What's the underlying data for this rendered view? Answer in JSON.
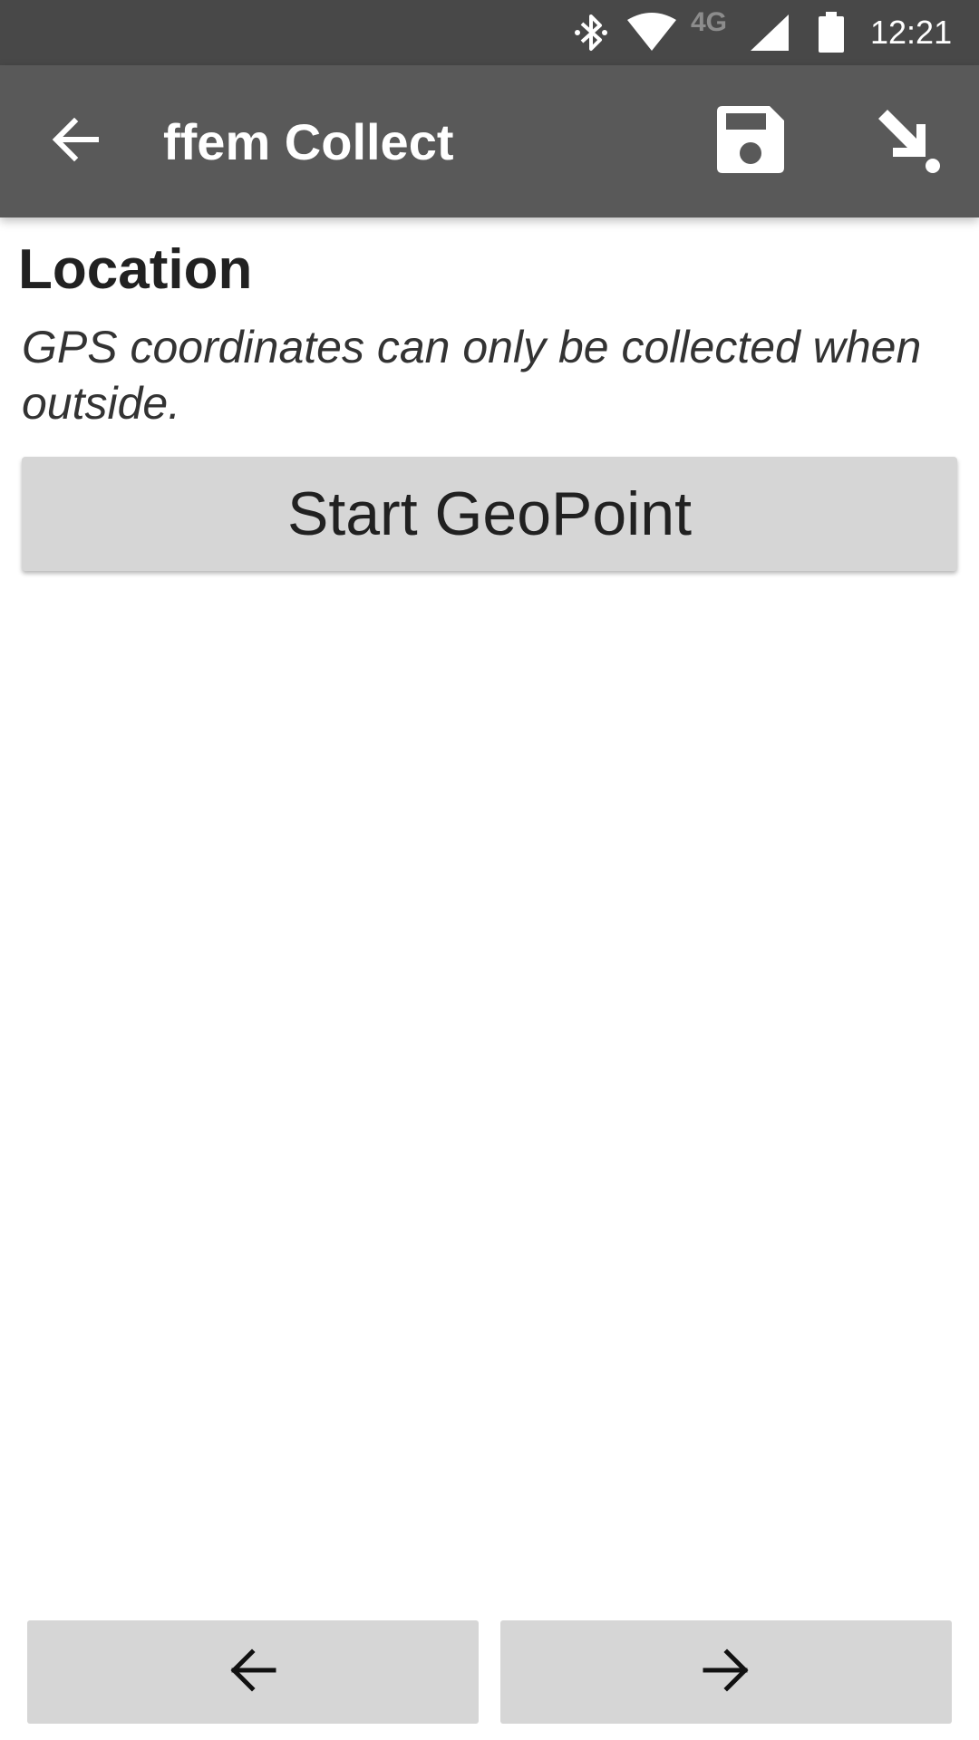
{
  "status_bar": {
    "time": "12:21",
    "network_label": "4G",
    "icons": [
      "bluetooth-icon",
      "wifi-icon",
      "cell-signal-icon",
      "battery-icon"
    ]
  },
  "toolbar": {
    "title": "ffem Collect",
    "icons": [
      "back-arrow-icon",
      "save-icon",
      "jump-to-icon"
    ]
  },
  "question": {
    "label": "Location",
    "hint": "GPS coordinates can only be collected when outside.",
    "button_label": "Start GeoPoint"
  },
  "navigation": {
    "icons": [
      "arrow-left-icon",
      "arrow-right-icon"
    ]
  },
  "colors": {
    "status_bar_bg": "#484848",
    "toolbar_bg": "#595959",
    "button_bg": "#d6d6d6",
    "text_dark": "#212121"
  }
}
